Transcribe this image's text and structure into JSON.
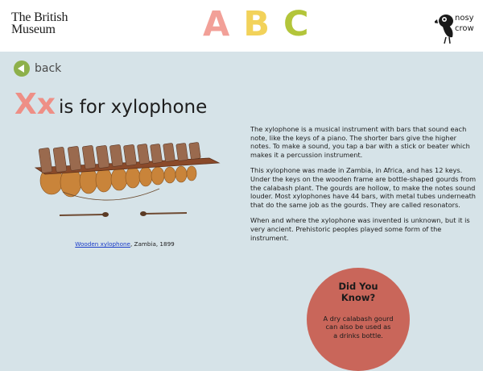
{
  "header": {
    "museum_line1": "The British",
    "museum_line2": "Museum",
    "abc_letters": [
      {
        "char": "A",
        "color": "#f2a098"
      },
      {
        "char": "B",
        "color": "#f2d25a"
      },
      {
        "char": "C",
        "color": "#b3c53a"
      }
    ],
    "publisher_line1": "nosy",
    "publisher_line2": "crow"
  },
  "nav": {
    "back_label": "back"
  },
  "title": {
    "letters": "Xx",
    "text": "is for xylophone"
  },
  "caption": {
    "link_text": "Wooden xylophone",
    "rest": ", Zambia, 1899"
  },
  "body": {
    "paragraphs": [
      "The xylophone is a musical instrument with bars that sound each note, like the keys of a piano. The shorter bars give the higher notes. To make a sound, you tap a bar with a stick or beater which makes it a percussion instrument.",
      "This xylophone was made in Zambia, in Africa, and has 12 keys. Under the keys on the wooden frame are bottle-shaped gourds from the calabash plant. The gourds are hollow, to make the notes sound louder. Most xylophones have 44 bars, with metal tubes underneath that do the same job as the gourds. They are called resonators.",
      "When and where the xylophone was invented is unknown, but it is very ancient. Prehistoric peoples played some form of the instrument."
    ]
  },
  "did_you_know": {
    "title": "Did You Know?",
    "text": "A dry calabash gourd can also be used as a drinks bottle."
  },
  "colors": {
    "background": "#d6e3e8",
    "accent_letters": "#ee8f86",
    "back_button": "#8db04a",
    "did_you_know_circle": "#c9665a",
    "link": "#1a3cc8"
  }
}
